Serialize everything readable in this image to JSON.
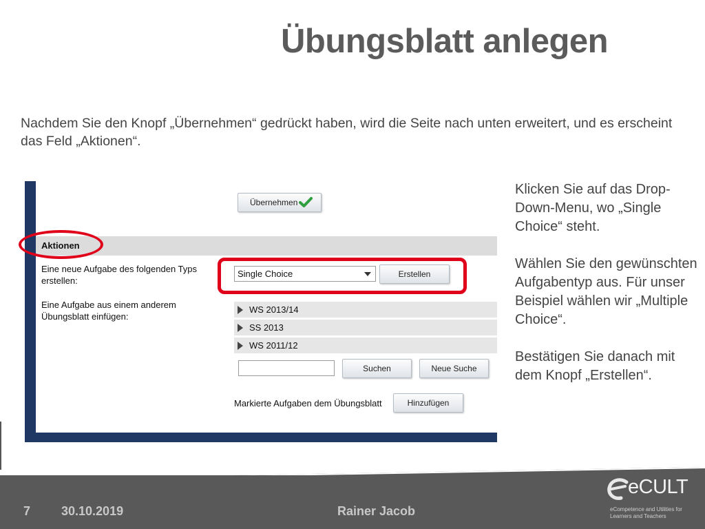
{
  "slide": {
    "title": "Übungsblatt anlegen",
    "intro": "Nachdem Sie den Knopf „Übernehmen“ gedrückt haben, wird die Seite nach unten erweitert, und es erscheint das Feld „Aktionen“.",
    "side_note": [
      "Klicken Sie auf das Drop-Down-Menu, wo „Single Choice“ steht.",
      "Wählen Sie  den gewünschten Aufgabentyp aus. Für unser Beispiel wählen wir „Multiple Choice“.",
      "Bestätigen Sie danach mit dem Knopf „Erstellen“."
    ]
  },
  "screenshot": {
    "uebernehmen_label": "Übernehmen",
    "section_title": "Aktionen",
    "new_task_label": "Eine neue Aufgabe des folgenden Typs erstellen:",
    "task_type_selected": "Single Choice",
    "create_label": "Erstellen",
    "import_label": "Eine Aufgabe aus einem anderem Übungsblatt einfügen:",
    "semesters": [
      "WS 2013/14",
      "SS 2013",
      "WS 2011/12"
    ],
    "search_value": "",
    "search_label": "Suchen",
    "new_search_label": "Neue Suche",
    "mark_label": "Markierte Aufgaben dem Übungsblatt",
    "add_label": "Hinzufügen"
  },
  "footer": {
    "page": "7",
    "date": "30.10.2019",
    "author": "Rainer Jacob",
    "logo": "eCULT",
    "logo_sub": "eCompetence and Utilities for Learners and Teachers"
  },
  "colors": {
    "annotation": "#e0001a",
    "frame": "#1f3864",
    "footer": "#595959",
    "check": "#2e9e3e"
  },
  "icons": [
    "check-icon",
    "dropdown-caret-icon",
    "expand-triangle-icon",
    "ecult-logo-icon"
  ]
}
